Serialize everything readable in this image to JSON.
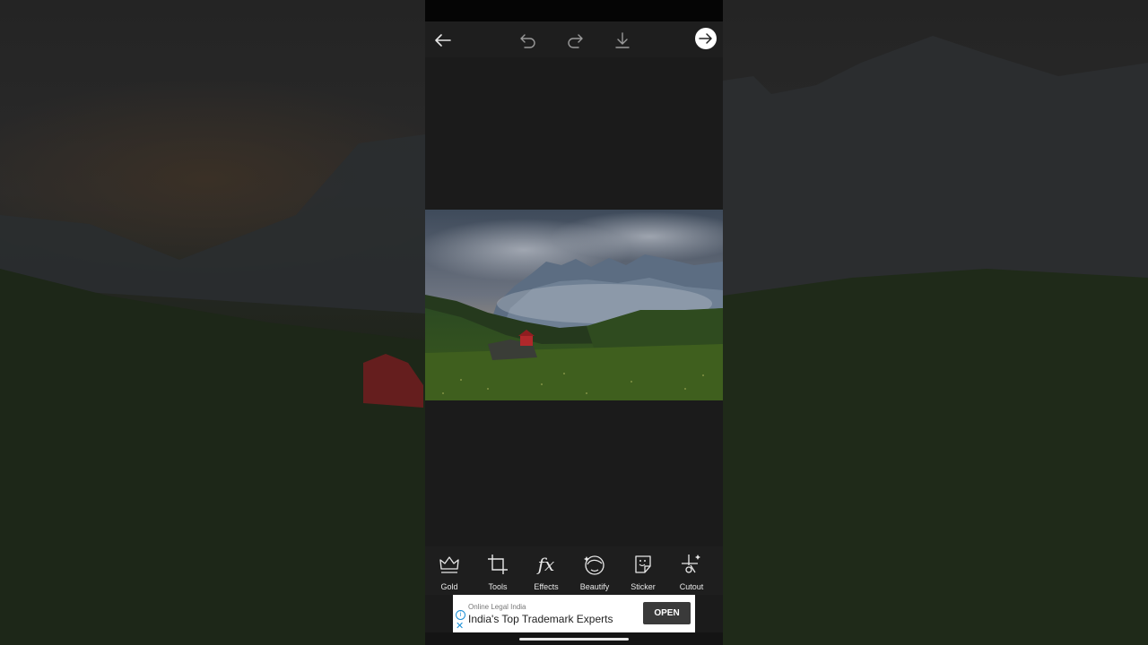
{
  "topbar": {
    "back_icon": "arrow-left-icon",
    "undo_icon": "undo-icon",
    "redo_icon": "redo-icon",
    "download_icon": "download-icon",
    "next_icon": "arrow-right-circle-icon"
  },
  "photo": {
    "subject": "",
    "colors": {
      "sky": "#4a5566",
      "mountain": "#5d6f84",
      "grass": "#2f4a1d",
      "barn": "#b0282b"
    }
  },
  "toolbar": {
    "items": [
      {
        "label": "Gold",
        "icon": "crown-icon"
      },
      {
        "label": "Tools",
        "icon": "crop-icon"
      },
      {
        "label": "Effects",
        "icon": "fx-icon"
      },
      {
        "label": "Beautify",
        "icon": "face-icon"
      },
      {
        "label": "Sticker",
        "icon": "sticker-icon"
      },
      {
        "label": "Cutout",
        "icon": "cutout-icon"
      }
    ]
  },
  "ad": {
    "advertiser": "Online Legal India",
    "headline": "India's Top Trademark Experts",
    "cta": "OPEN"
  },
  "colors": {
    "accent": "#ffffff",
    "panel": "#1e1e1e",
    "canvas": "#1b1b1b",
    "ad_info": "#1a8fd6"
  }
}
